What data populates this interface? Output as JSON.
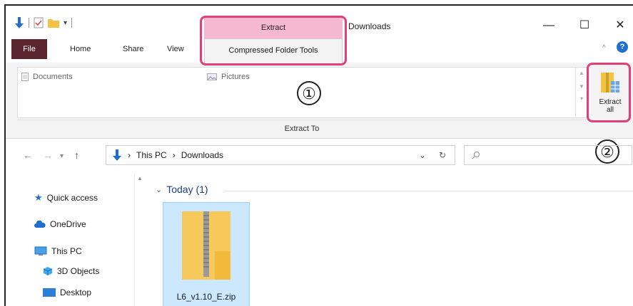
{
  "window": {
    "title": "Downloads",
    "minimize_glyph": "—",
    "maximize_glyph": "☐",
    "close_glyph": "✕"
  },
  "quick_access_toolbar": {
    "icons": [
      "down-arrow-icon",
      "properties-icon",
      "new-folder-icon",
      "customize-dropdown-icon"
    ]
  },
  "ribbon": {
    "context_group_label": "Extract",
    "context_tab_label": "Compressed Folder Tools",
    "tabs": [
      {
        "label": "File"
      },
      {
        "label": "Home"
      },
      {
        "label": "Share"
      },
      {
        "label": "View"
      }
    ],
    "gallery_items": [
      {
        "label": "Documents"
      },
      {
        "label": "Pictures"
      }
    ],
    "group_label": "Extract To",
    "extract_all_label_line1": "Extract",
    "extract_all_label_line2": "all"
  },
  "annotations": {
    "marker1": "①",
    "marker2": "②"
  },
  "address_bar": {
    "path": [
      "This PC",
      "Downloads"
    ],
    "search_placeholder": ""
  },
  "nav_pane": {
    "items": [
      {
        "label": "Quick access",
        "icon": "star-icon"
      },
      {
        "label": "OneDrive",
        "icon": "cloud-icon"
      },
      {
        "label": "This PC",
        "icon": "monitor-icon"
      },
      {
        "label": "3D Objects",
        "icon": "cube-icon"
      },
      {
        "label": "Desktop",
        "icon": "desktop-folder-icon"
      }
    ]
  },
  "content": {
    "group_header": "Today (1)",
    "files": [
      {
        "name": "L6_v1.10_E.zip",
        "type": "zip-folder-icon",
        "selected": true
      }
    ]
  },
  "colors": {
    "accent": "#e0407a",
    "context_tab": "#f6b8d0",
    "file_tab": "#5b2530",
    "selection": "#cce8ff"
  }
}
